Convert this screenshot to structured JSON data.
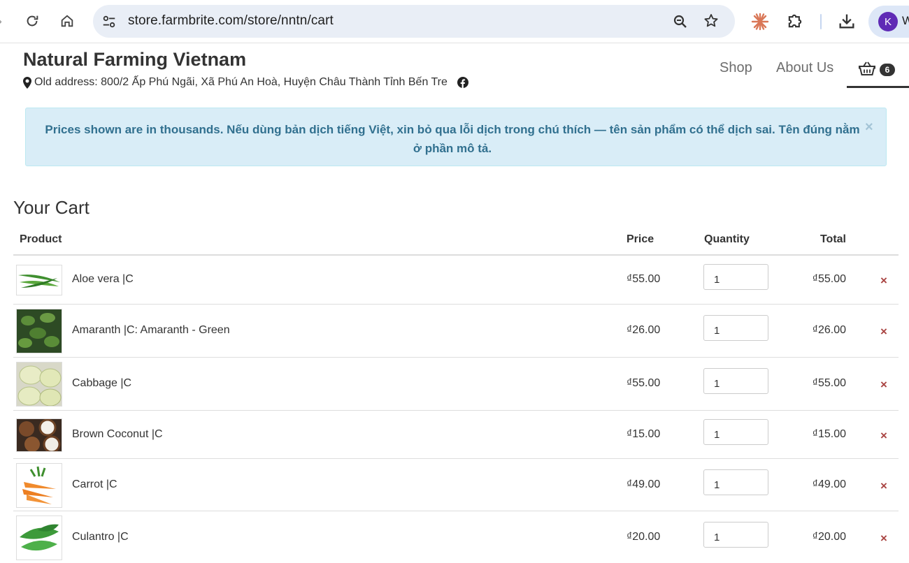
{
  "browser": {
    "url_host": "store.farmbrite.com",
    "url_path": "/store/nntn/cart",
    "profile_initial": "K",
    "profile_name_partial": "W"
  },
  "site": {
    "title": "Natural Farming Vietnam",
    "address": "Old address: 800/2 Ấp Phú Ngãi, Xã Phú An Hoà, Huyện Châu Thành Tỉnh Bến Tre"
  },
  "nav": {
    "shop": "Shop",
    "about": "About Us",
    "cart_count": "6"
  },
  "alert": {
    "message": "Prices shown are in thousands. Nếu dùng bản dịch tiếng Việt, xin bỏ qua lỗi dịch trong chú thích — tên sản phẩm có thể dịch sai. Tên đúng nằm ở phần mô tả.",
    "close": "×"
  },
  "cart": {
    "title": "Your Cart",
    "headers": {
      "product": "Product",
      "price": "Price",
      "quantity": "Quantity",
      "total": "Total"
    },
    "remove_symbol": "×",
    "items": [
      {
        "name": "Aloe vera |C",
        "price": "₫55.00",
        "quantity": "1",
        "total": "₫55.00",
        "image": "aloe-vera"
      },
      {
        "name": "Amaranth |C: Amaranth - Green",
        "price": "₫26.00",
        "quantity": "1",
        "total": "₫26.00",
        "image": "amaranth"
      },
      {
        "name": "Cabbage |C",
        "price": "₫55.00",
        "quantity": "1",
        "total": "₫55.00",
        "image": "cabbage"
      },
      {
        "name": "Brown Coconut |C",
        "price": "₫15.00",
        "quantity": "1",
        "total": "₫15.00",
        "image": "coconut"
      },
      {
        "name": "Carrot |C",
        "price": "₫49.00",
        "quantity": "1",
        "total": "₫49.00",
        "image": "carrot"
      },
      {
        "name": "Culantro |C",
        "price": "₫20.00",
        "quantity": "1",
        "total": "₫20.00",
        "image": "culantro"
      }
    ]
  },
  "colors": {
    "alert_bg": "#d9edf7",
    "alert_text": "#31708f",
    "remove": "#a94442",
    "profile": "#5f2ab5"
  }
}
